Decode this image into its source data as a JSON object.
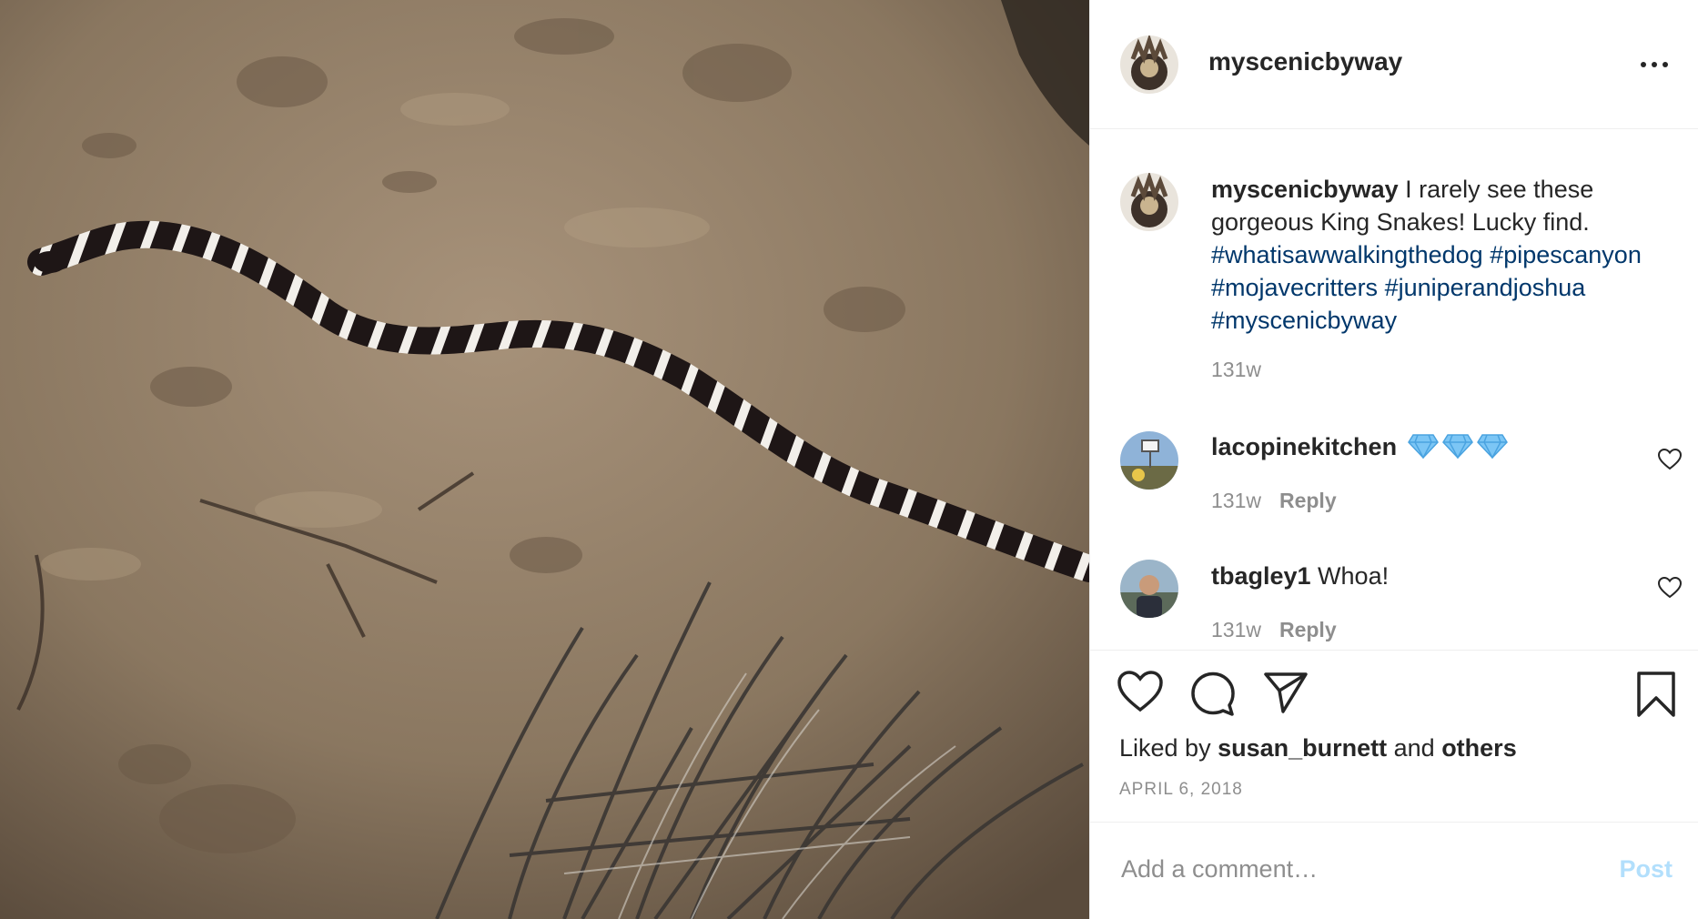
{
  "header": {
    "username": "myscenicbyway",
    "more_icon": "ellipsis-icon"
  },
  "caption": {
    "username": "myscenicbyway",
    "text": " I rarely see these gorgeous King Snakes! Lucky find. ",
    "hashtags": [
      "#whatisawwalkingthedog",
      "#pipescanyon",
      "#mojavecritters",
      "#juniperandjoshua",
      "#myscenicbyway"
    ],
    "timestamp": "131w"
  },
  "comments": [
    {
      "username": "lacopinekitchen",
      "text": "",
      "emoji": "gem-emoji",
      "emoji_count": 3,
      "timestamp": "131w",
      "reply_label": "Reply"
    },
    {
      "username": "tbagley1",
      "text": " Whoa!",
      "timestamp": "131w",
      "reply_label": "Reply"
    }
  ],
  "actions": {
    "icons": [
      "heart-icon",
      "comment-icon",
      "share-icon",
      "bookmark-icon"
    ]
  },
  "likes": {
    "prefix": "Liked by ",
    "user": "susan_burnett",
    "middle": " and ",
    "others": "others"
  },
  "date": "APRIL 6, 2018",
  "add_comment": {
    "placeholder": "Add a comment…",
    "post_label": "Post"
  },
  "colors": {
    "hashtag": "#00376b",
    "post_button_disabled": "#b2dffc",
    "secondary_text": "#8e8e8e"
  }
}
